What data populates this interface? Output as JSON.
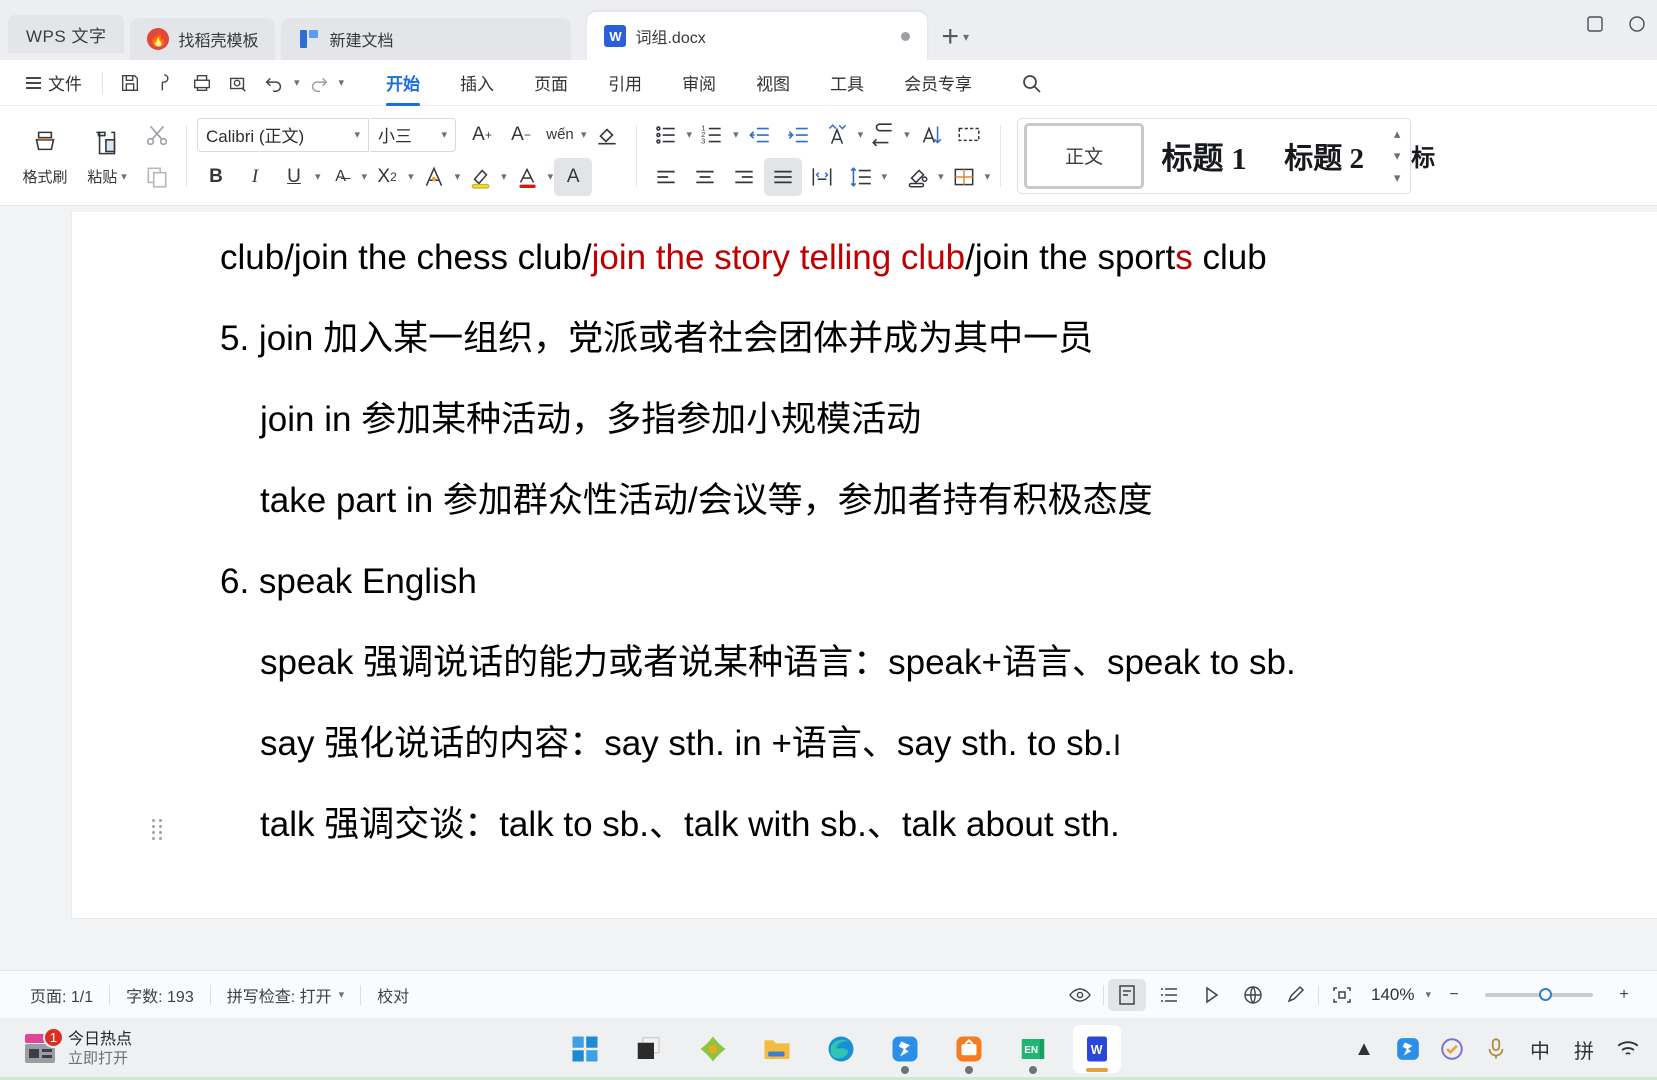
{
  "window": {
    "app_label": "WPS 文字",
    "tabs": [
      {
        "name": "找稻壳模板",
        "icon": "flame-icon",
        "active": false
      },
      {
        "name": "新建文档",
        "icon": "new-doc-icon",
        "active": false
      },
      {
        "name": "词组.docx",
        "icon": "word-doc-icon",
        "active": true
      }
    ],
    "new_tab_label": "+",
    "controls": [
      "restore-window",
      "close-window"
    ]
  },
  "menubar": {
    "file_label": "文件",
    "quick_access": [
      "save-icon",
      "search-save-icon",
      "print-icon",
      "print-preview-icon",
      "undo-icon",
      "redo-icon",
      "more-icon"
    ],
    "tabs": [
      {
        "label": "开始",
        "active": true
      },
      {
        "label": "插入",
        "active": false
      },
      {
        "label": "页面",
        "active": false
      },
      {
        "label": "引用",
        "active": false
      },
      {
        "label": "审阅",
        "active": false
      },
      {
        "label": "视图",
        "active": false
      },
      {
        "label": "工具",
        "active": false
      },
      {
        "label": "会员专享",
        "active": false
      }
    ],
    "search_icon": "search-icon"
  },
  "ribbon": {
    "format_painter": "格式刷",
    "paste": "粘贴",
    "copy_icon": "copy-icon",
    "cut_icon": "cut-icon",
    "font_name": "Calibri (正文)",
    "font_size": "小三",
    "font_tools": [
      "grow-font",
      "shrink-font",
      "pinyin-guide",
      "clear-format"
    ],
    "text_buttons": [
      "B",
      "I",
      "U",
      "S",
      "X²"
    ],
    "text_extra": [
      "text-effects",
      "highlight",
      "font-color",
      "character-shading"
    ],
    "para_tools_row1": [
      "bullet-list",
      "numbered-list",
      "decrease-indent",
      "increase-indent",
      "sort-az",
      "show-marks",
      "sort-desc",
      "table-grid"
    ],
    "para_tools_row2": [
      "align-left",
      "align-center",
      "align-right",
      "align-justify",
      "distribute",
      "line-spacing",
      "shading",
      "borders"
    ],
    "styles": [
      {
        "label": "正文",
        "selected": true
      },
      {
        "label": "标题 1",
        "selected": false
      },
      {
        "label": "标题 2",
        "selected": false
      }
    ],
    "styles_more": "标"
  },
  "document": {
    "lines": [
      {
        "indent": 0,
        "segments": [
          {
            "text": "club/join the chess club/",
            "color": "black"
          },
          {
            "text": "join the story telling club",
            "color": "red"
          },
          {
            "text": "/join the sport",
            "color": "black"
          },
          {
            "text": "s",
            "color": "red"
          },
          {
            "text": " club",
            "color": "black"
          }
        ]
      },
      {
        "indent": 0,
        "segments": [
          {
            "text": "5. join 加入某一组织，党派或者社会团体并成为其中一员",
            "color": "black"
          }
        ]
      },
      {
        "indent": 1,
        "segments": [
          {
            "text": "join in  参加某种活动，多指参加小规模活动",
            "color": "black"
          }
        ]
      },
      {
        "indent": 1,
        "segments": [
          {
            "text": "take part in 参加群众性活动/会议等，参加者持有积极态度",
            "color": "black"
          }
        ]
      },
      {
        "indent": 0,
        "segments": [
          {
            "text": "6. speak English",
            "color": "black"
          }
        ]
      },
      {
        "indent": 1,
        "segments": [
          {
            "text": "speak 强调说话的能力或者说某种语言：speak+语言、speak to sb.",
            "color": "black"
          }
        ]
      },
      {
        "indent": 1,
        "segments": [
          {
            "text": "say 强化说话的内容：say sth. in +语言、say sth. to sb.",
            "color": "black"
          }
        ]
      },
      {
        "indent": 1,
        "segments": [
          {
            "text": "talk 强调交谈：talk to sb.、talk with sb.、talk about sth.",
            "color": "black"
          }
        ]
      }
    ],
    "accent_red": "#c00000"
  },
  "statusbar": {
    "page": "页面: 1/1",
    "words": "字数: 193",
    "spellcheck": "拼写检查: 打开",
    "proofread": "校对",
    "view_icons": [
      "eye-icon",
      "print-layout-icon",
      "outline-icon",
      "reading-icon",
      "web-layout-icon",
      "pen-icon",
      "fullscreen-icon"
    ],
    "zoom": "140%",
    "zoom_out": "−",
    "zoom_in": "+"
  },
  "taskbar": {
    "hotspot_title": "今日热点",
    "hotspot_sub": "立即打开",
    "hotspot_badge": "1",
    "apps": [
      "windows-start-icon",
      "task-view-icon",
      "flower-app-icon",
      "file-explorer-icon",
      "edge-browser-icon",
      "wps-cloud-icon",
      "video-app-icon",
      "eudic-en-icon",
      "wps-writer-icon"
    ],
    "tray": [
      "chevron-up-icon",
      "wps-tray-icon",
      "check-circle-icon",
      "microphone-icon",
      "中",
      "拼",
      "wifi-icon"
    ]
  }
}
